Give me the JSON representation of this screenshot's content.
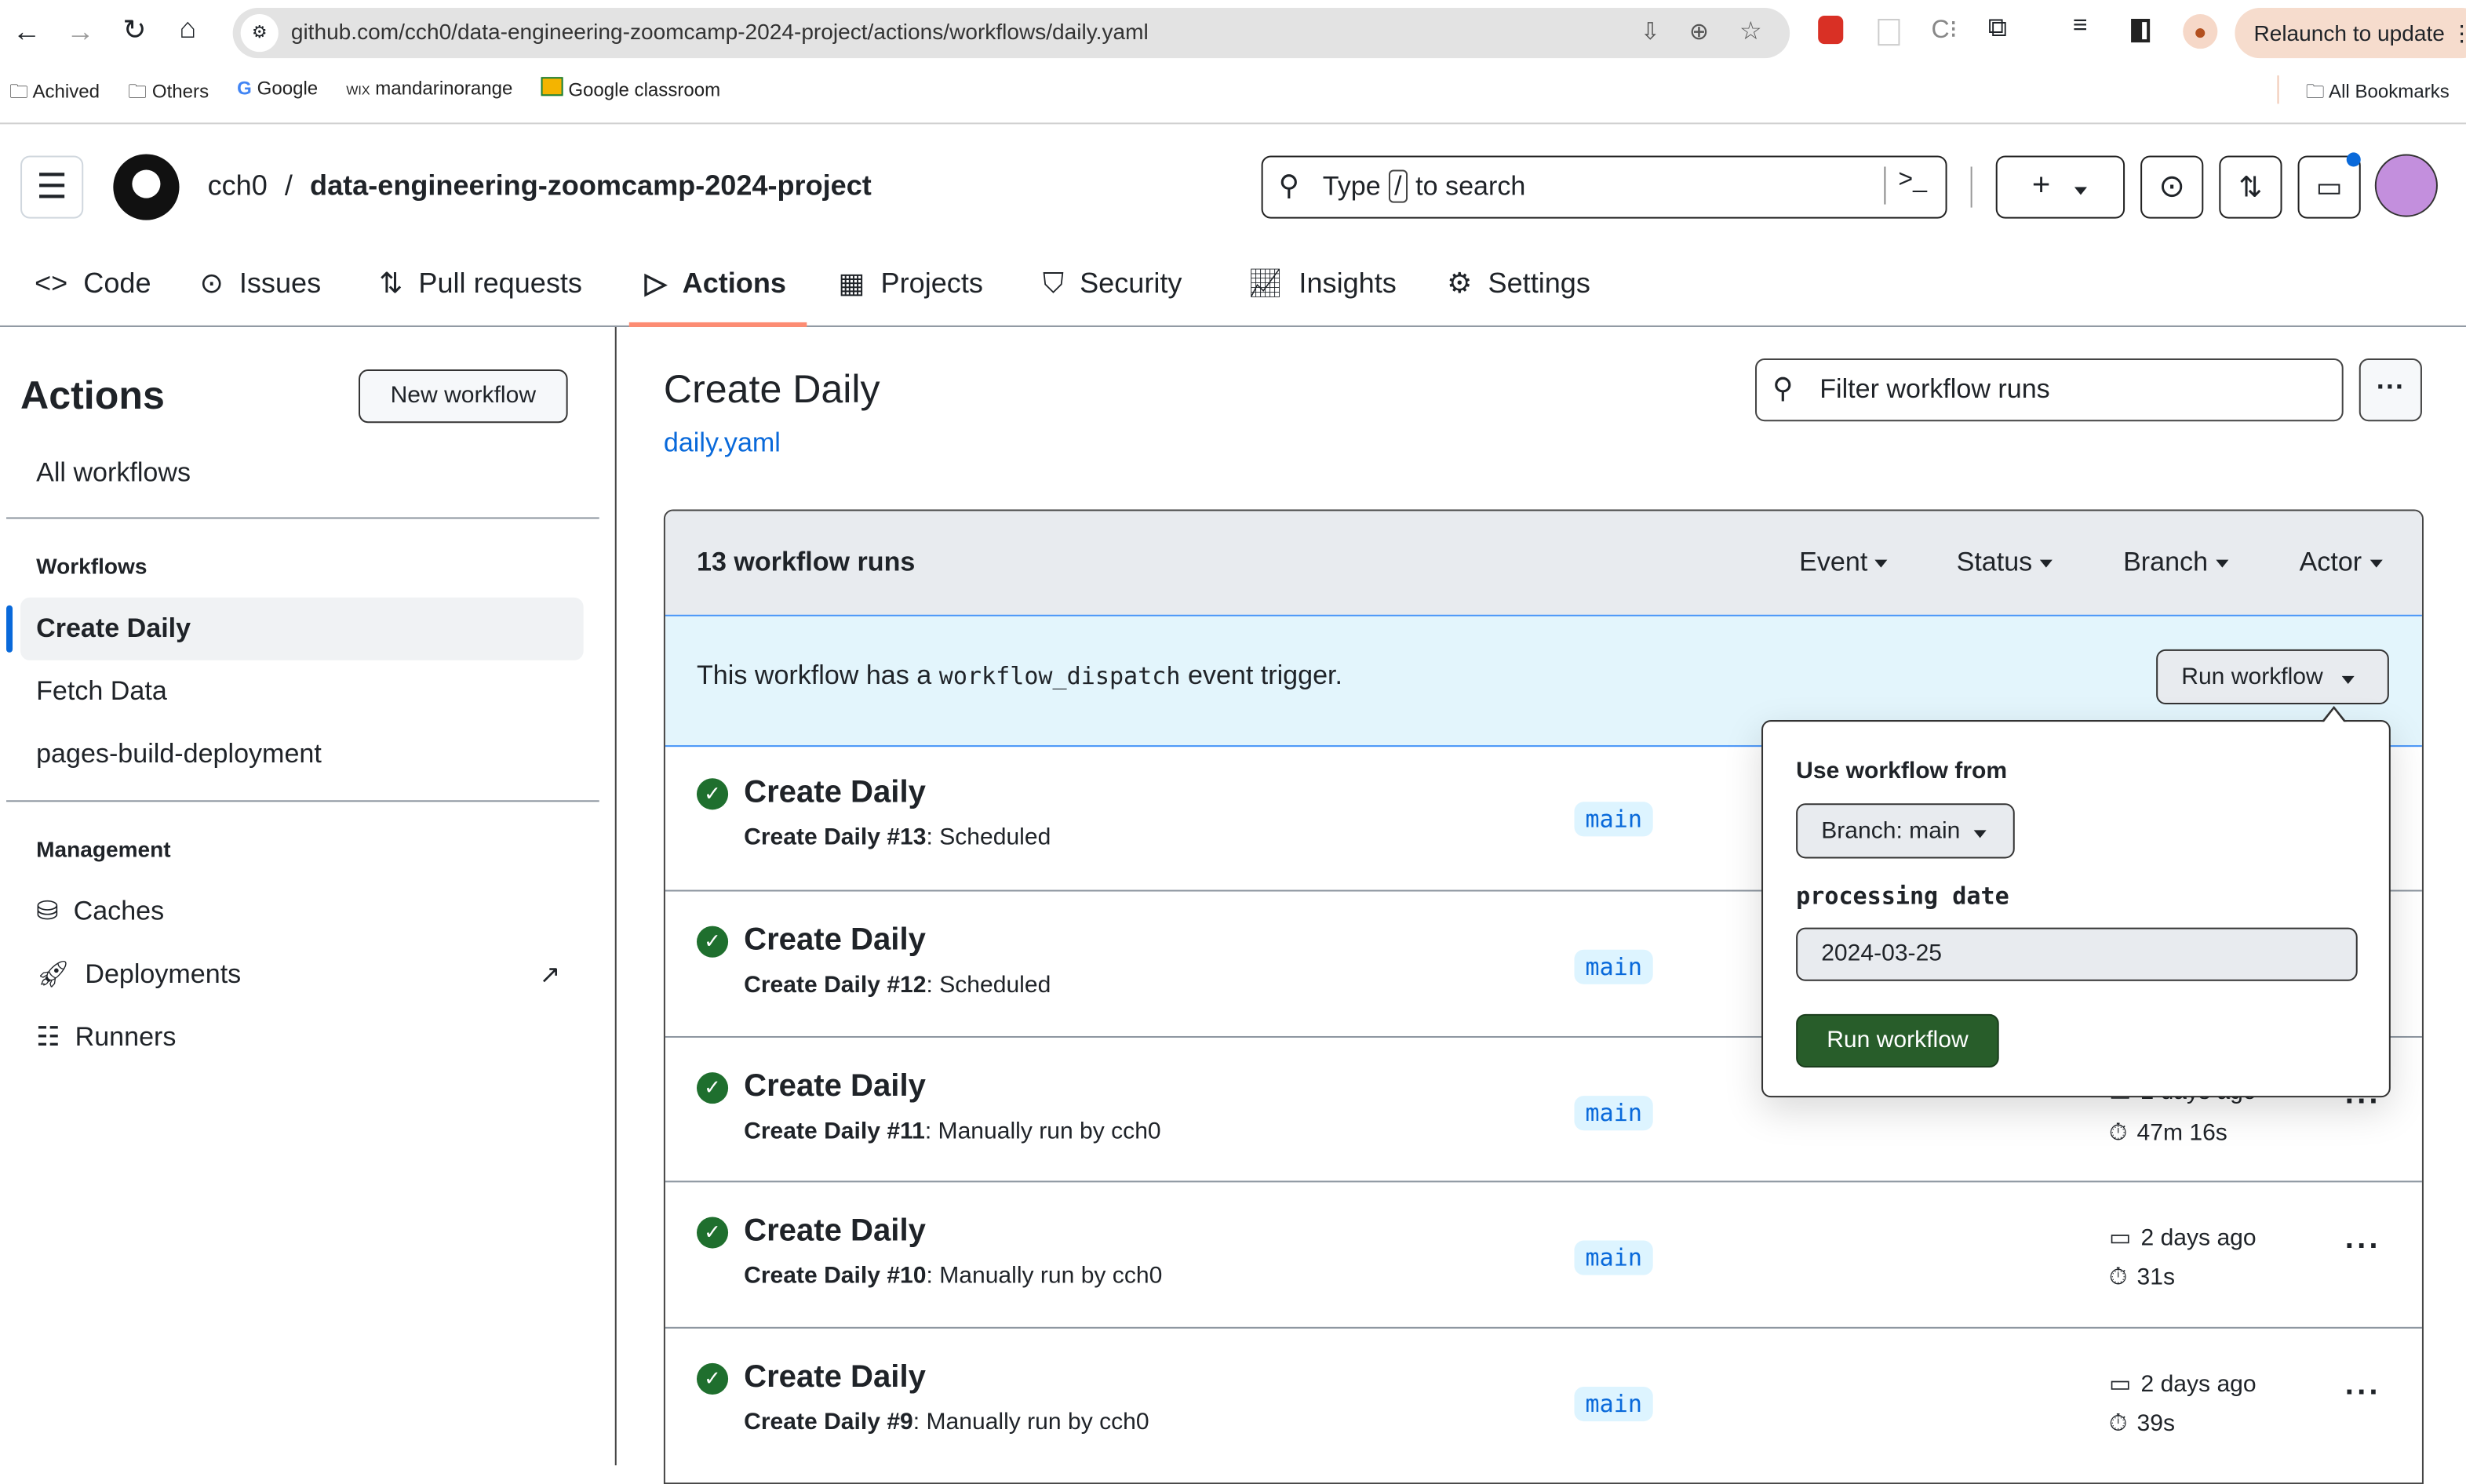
{
  "browser": {
    "url": "github.com/cch0/data-engineering-zoomcamp-2024-project/actions/workflows/daily.yaml",
    "relaunch_label": "Relaunch to update",
    "bookmarks": [
      {
        "label": "Achived",
        "icon": "folder-icon"
      },
      {
        "label": "Others",
        "icon": "folder-icon"
      },
      {
        "label": "Google",
        "icon": "google-icon"
      },
      {
        "label": "mandarinorange",
        "icon": "wix-icon"
      },
      {
        "label": "Google classroom",
        "icon": "classroom-icon"
      }
    ],
    "all_bookmarks": "All Bookmarks"
  },
  "header": {
    "owner": "cch0",
    "separator": "/",
    "repo": "data-engineering-zoomcamp-2024-project",
    "search_prefix": "Type",
    "search_key": "/",
    "search_suffix": "to search"
  },
  "tabs": [
    {
      "label": "Code",
      "icon": "code-icon"
    },
    {
      "label": "Issues",
      "icon": "issue-icon"
    },
    {
      "label": "Pull requests",
      "icon": "pull-request-icon"
    },
    {
      "label": "Actions",
      "icon": "play-icon",
      "active": true
    },
    {
      "label": "Projects",
      "icon": "table-icon"
    },
    {
      "label": "Security",
      "icon": "shield-icon"
    },
    {
      "label": "Insights",
      "icon": "graph-icon"
    },
    {
      "label": "Settings",
      "icon": "gear-icon"
    }
  ],
  "sidebar": {
    "title": "Actions",
    "new_workflow": "New workflow",
    "all_workflows": "All workflows",
    "workflows_heading": "Workflows",
    "workflows": [
      "Create Daily",
      "Fetch Data",
      "pages-build-deployment"
    ],
    "management_heading": "Management",
    "management": [
      {
        "label": "Caches",
        "icon": "database-icon"
      },
      {
        "label": "Deployments",
        "icon": "rocket-icon"
      },
      {
        "label": "Runners",
        "icon": "server-icon"
      }
    ]
  },
  "main": {
    "title": "Create Daily",
    "file": "daily.yaml",
    "filter_placeholder": "Filter workflow runs",
    "count": "13 workflow runs",
    "filters": [
      "Event",
      "Status",
      "Branch",
      "Actor"
    ],
    "dispatch": {
      "pre": "This workflow has a",
      "code": "workflow_dispatch",
      "post": "event trigger.",
      "button": "Run workflow"
    },
    "popover": {
      "use_from": "Use workflow from",
      "branch": "Branch: main",
      "input_label": "processing date",
      "input_value": "2024-03-25",
      "submit": "Run workflow"
    },
    "runs": [
      {
        "title": "Create Daily",
        "name": "Create Daily",
        "num": "#13",
        "desc": ": Scheduled",
        "branch": "main",
        "when": "",
        "duration": ""
      },
      {
        "title": "Create Daily",
        "name": "Create Daily",
        "num": "#12",
        "desc": ": Scheduled",
        "branch": "main",
        "when": "",
        "duration": ""
      },
      {
        "title": "Create Daily",
        "name": "Create Daily",
        "num": "#11",
        "desc": ": Manually run by cch0",
        "branch": "main",
        "when": "2 days ago",
        "duration": "47m 16s"
      },
      {
        "title": "Create Daily",
        "name": "Create Daily",
        "num": "#10",
        "desc": ": Manually run by cch0",
        "branch": "main",
        "when": "2 days ago",
        "duration": "31s"
      },
      {
        "title": "Create Daily",
        "name": "Create Daily",
        "num": "#9",
        "desc": ": Manually run by cch0",
        "branch": "main",
        "when": "2 days ago",
        "duration": "39s"
      }
    ]
  },
  "colors": {
    "accent": "#fd8c73",
    "success": "#1f6f2e",
    "link": "#0969da",
    "banner": "#e3f5fc"
  }
}
